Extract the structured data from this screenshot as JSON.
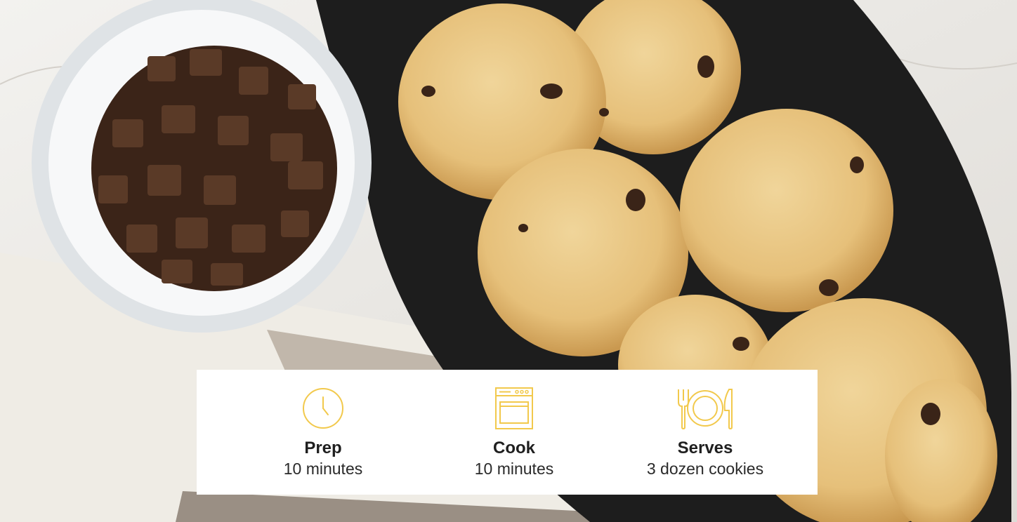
{
  "accent_color": "#f2c94c",
  "hero": {
    "icon_names": [
      "chocolate-chunks-bowl",
      "cookie-platter",
      "striped-towel"
    ]
  },
  "info_card": {
    "items": [
      {
        "icon": "clock-icon",
        "label": "Prep",
        "value": "10 minutes"
      },
      {
        "icon": "oven-icon",
        "label": "Cook",
        "value": "10 minutes"
      },
      {
        "icon": "plate-icon",
        "label": "Serves",
        "value": "3 dozen cookies"
      }
    ]
  }
}
